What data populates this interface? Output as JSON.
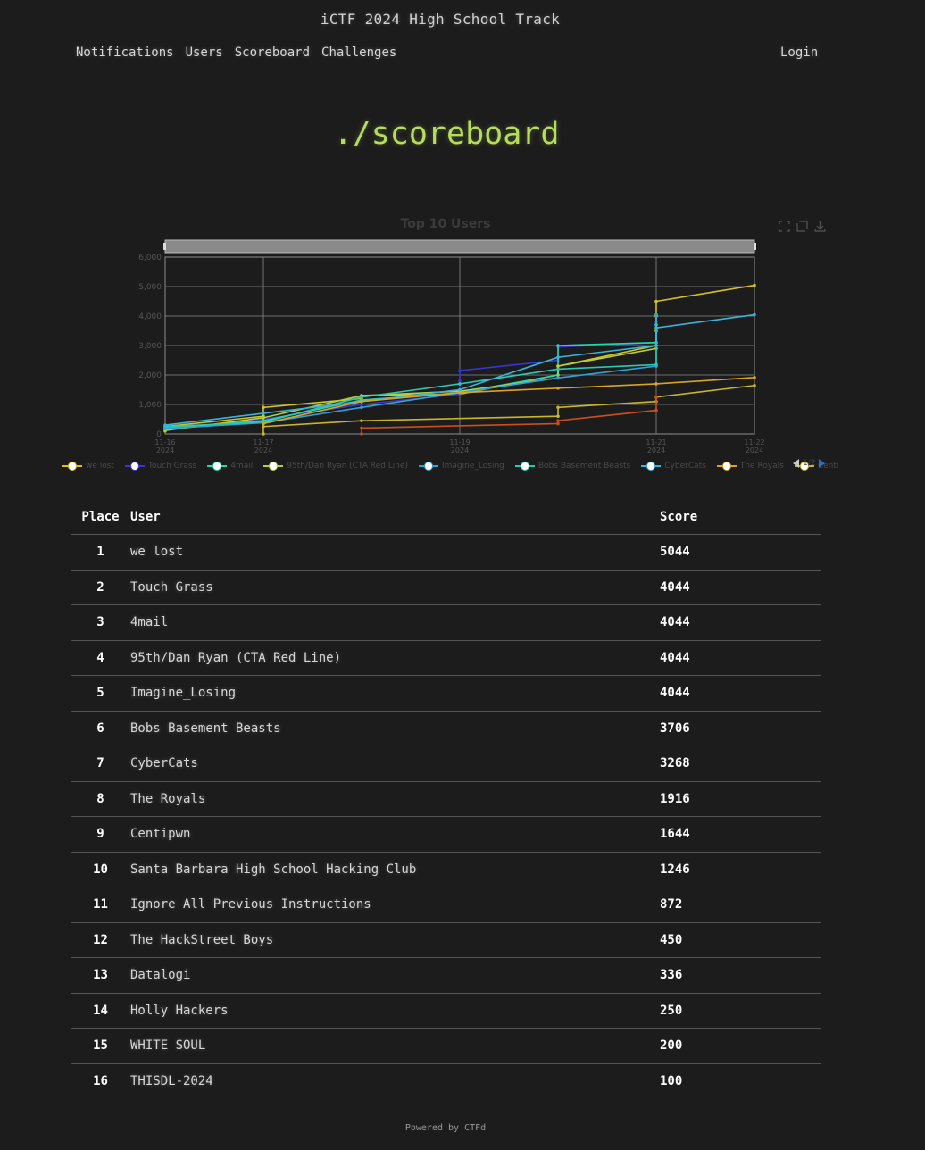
{
  "site": {
    "title": "iCTF 2024 High School Track"
  },
  "nav": {
    "items": [
      "Notifications",
      "Users",
      "Scoreboard",
      "Challenges"
    ],
    "login": "Login"
  },
  "page": {
    "heading": "./scoreboard"
  },
  "chart_data": {
    "type": "line",
    "title": "Top 10 Users",
    "ylim": [
      0,
      6000
    ],
    "yticks": [
      "0",
      "1,000",
      "2,000",
      "3,000",
      "4,000",
      "5,000",
      "6,000"
    ],
    "xticks": [
      {
        "x": "2024-11-16",
        "label": "11-16\n2024"
      },
      {
        "x": "2024-11-17",
        "label": "11-17\n2024"
      },
      {
        "x": "2024-11-19",
        "label": "11-19\n2024"
      },
      {
        "x": "2024-11-21",
        "label": "11-21\n2024"
      },
      {
        "x": "2024-11-22",
        "label": "11-22\n2024"
      }
    ],
    "xlim": [
      "2024-11-16",
      "2024-11-22"
    ],
    "grid": true,
    "legend_position": "bottom",
    "legend_page": "1/2",
    "series": [
      {
        "name": "we lost",
        "color": "#d4c126",
        "points": [
          [
            "2024-11-16",
            100
          ],
          [
            "2024-11-16",
            250
          ],
          [
            "2024-11-17",
            600
          ],
          [
            "2024-11-17",
            900
          ],
          [
            "2024-11-18",
            1200
          ],
          [
            "2024-11-18",
            1300
          ],
          [
            "2024-11-19",
            1350
          ],
          [
            "2024-11-20",
            2000
          ],
          [
            "2024-11-20",
            2300
          ],
          [
            "2024-11-21",
            3000
          ],
          [
            "2024-11-21",
            3500
          ],
          [
            "2024-11-21",
            4000
          ],
          [
            "2024-11-21",
            4500
          ],
          [
            "2024-11-22",
            5044
          ]
        ]
      },
      {
        "name": "Touch Grass",
        "color": "#3a35d6",
        "points": [
          [
            "2024-11-16",
            150
          ],
          [
            "2024-11-17",
            500
          ],
          [
            "2024-11-18",
            1000
          ],
          [
            "2024-11-19",
            1350
          ],
          [
            "2024-11-19",
            1800
          ],
          [
            "2024-11-19",
            2150
          ],
          [
            "2024-11-20",
            2500
          ],
          [
            "2024-11-20",
            2950
          ],
          [
            "2024-11-21",
            3100
          ],
          [
            "2024-11-21",
            3800
          ],
          [
            "2024-11-21",
            4044
          ]
        ]
      },
      {
        "name": "4mail",
        "color": "#26d6a6",
        "points": [
          [
            "2024-11-16",
            200
          ],
          [
            "2024-11-17",
            450
          ],
          [
            "2024-11-18",
            1150
          ],
          [
            "2024-11-19",
            1400
          ],
          [
            "2024-11-20",
            2000
          ],
          [
            "2024-11-20",
            3000
          ],
          [
            "2024-11-21",
            3100
          ],
          [
            "2024-11-21",
            4044
          ]
        ]
      },
      {
        "name": "95th/Dan Ryan (CTA Red Line)",
        "color": "#b3cf3a",
        "points": [
          [
            "2024-11-16",
            120
          ],
          [
            "2024-11-17",
            550
          ],
          [
            "2024-11-18",
            1300
          ],
          [
            "2024-11-19",
            1450
          ],
          [
            "2024-11-20",
            1900
          ],
          [
            "2024-11-20",
            2300
          ],
          [
            "2024-11-21",
            2900
          ],
          [
            "2024-11-21",
            4044
          ]
        ]
      },
      {
        "name": "Imagine_Losing",
        "color": "#2fa0d8",
        "points": [
          [
            "2024-11-16",
            180
          ],
          [
            "2024-11-17",
            380
          ],
          [
            "2024-11-18",
            900
          ],
          [
            "2024-11-19",
            1400
          ],
          [
            "2024-11-20",
            1900
          ],
          [
            "2024-11-21",
            2300
          ],
          [
            "2024-11-21",
            3000
          ],
          [
            "2024-11-21",
            4044
          ]
        ]
      },
      {
        "name": "Bobs Basement Beasts",
        "color": "#2cc7b0",
        "points": [
          [
            "2024-11-16",
            250
          ],
          [
            "2024-11-17",
            400
          ],
          [
            "2024-11-18",
            1250
          ],
          [
            "2024-11-19",
            1700
          ],
          [
            "2024-11-20",
            2200
          ],
          [
            "2024-11-21",
            2350
          ],
          [
            "2024-11-21",
            3706
          ]
        ]
      },
      {
        "name": "CyberCats",
        "color": "#3bb3d8",
        "points": [
          [
            "2024-11-16",
            300
          ],
          [
            "2024-11-17",
            700
          ],
          [
            "2024-11-18",
            1100
          ],
          [
            "2024-11-19",
            1500
          ],
          [
            "2024-11-20",
            2600
          ],
          [
            "2024-11-21",
            3000
          ],
          [
            "2024-11-21",
            3600
          ],
          [
            "2024-11-22",
            4044
          ]
        ]
      },
      {
        "name": "The Royals",
        "color": "#d8a424",
        "points": [
          [
            "2024-11-17",
            350
          ],
          [
            "2024-11-18",
            1100
          ],
          [
            "2024-11-19",
            1400
          ],
          [
            "2024-11-20",
            1550
          ],
          [
            "2024-11-21",
            1700
          ],
          [
            "2024-11-22",
            1916
          ]
        ]
      },
      {
        "name": "Centipwn",
        "color": "#c7b52a",
        "points": [
          [
            "2024-11-17",
            0
          ],
          [
            "2024-11-17",
            250
          ],
          [
            "2024-11-18",
            450
          ],
          [
            "2024-11-20",
            600
          ],
          [
            "2024-11-20",
            900
          ],
          [
            "2024-11-21",
            1100
          ],
          [
            "2024-11-21",
            1250
          ],
          [
            "2024-11-22",
            1644
          ]
        ]
      },
      {
        "name": "Santa Barbara High School Hacking Club",
        "color": "#c9501c",
        "points": [
          [
            "2024-11-18",
            0
          ],
          [
            "2024-11-18",
            200
          ],
          [
            "2024-11-20",
            350
          ],
          [
            "2024-11-20",
            450
          ],
          [
            "2024-11-21",
            800
          ],
          [
            "2024-11-21",
            1246
          ]
        ]
      }
    ]
  },
  "legend_labels": [
    "we lost",
    "Touch Grass",
    "4mail",
    "95th/Dan Ryan (CTA Red Line)",
    "Imagine_Losing",
    "Bobs Basement Beasts",
    "CyberCats",
    "The Royals",
    "Centip"
  ],
  "table": {
    "headers": {
      "place": "Place",
      "user": "User",
      "score": "Score"
    },
    "rows": [
      {
        "place": "1",
        "user": "we lost",
        "score": "5044"
      },
      {
        "place": "2",
        "user": "Touch Grass",
        "score": "4044"
      },
      {
        "place": "3",
        "user": "4mail",
        "score": "4044"
      },
      {
        "place": "4",
        "user": "95th/Dan Ryan (CTA Red Line)",
        "score": "4044"
      },
      {
        "place": "5",
        "user": "Imagine_Losing",
        "score": "4044"
      },
      {
        "place": "6",
        "user": "Bobs Basement Beasts",
        "score": "3706"
      },
      {
        "place": "7",
        "user": "CyberCats",
        "score": "3268"
      },
      {
        "place": "8",
        "user": "The Royals",
        "score": "1916"
      },
      {
        "place": "9",
        "user": "Centipwn",
        "score": "1644"
      },
      {
        "place": "10",
        "user": "Santa Barbara High School Hacking Club",
        "score": "1246"
      },
      {
        "place": "11",
        "user": "Ignore All Previous Instructions",
        "score": "872"
      },
      {
        "place": "12",
        "user": "The HackStreet Boys",
        "score": "450"
      },
      {
        "place": "13",
        "user": "Datalogi",
        "score": "336"
      },
      {
        "place": "14",
        "user": "Holly Hackers",
        "score": "250"
      },
      {
        "place": "15",
        "user": "WHITE SOUL",
        "score": "200"
      },
      {
        "place": "16",
        "user": "THISDL-2024",
        "score": "100"
      }
    ]
  },
  "footer": {
    "text": "Powered by CTFd"
  },
  "icons": {
    "toolbox": [
      "zoom-icon",
      "zoom-reset-icon",
      "download-icon"
    ]
  }
}
